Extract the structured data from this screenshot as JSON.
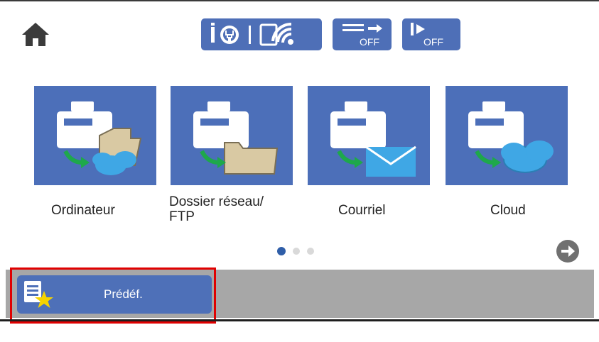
{
  "header": {
    "home_icon": "home-icon",
    "status_icons": [
      "wifi-direct-icon",
      "wifi-icon",
      "fax-forward-off-icon",
      "quiet-mode-off-icon"
    ],
    "off_label": "OFF"
  },
  "tiles": [
    {
      "label": "Ordinateur",
      "icon": "computer-scan-icon"
    },
    {
      "label": "Dossier réseau/\nFTP",
      "icon": "network-folder-scan-icon"
    },
    {
      "label": "Courriel",
      "icon": "email-scan-icon"
    },
    {
      "label": "Cloud",
      "icon": "cloud-scan-icon"
    }
  ],
  "pagination": {
    "pages": 3,
    "current": 1
  },
  "preset": {
    "label": "Prédéf.",
    "icon": "presets-icon"
  },
  "colors": {
    "tile_bg": "#4c6fb9",
    "button_bg": "#4e70b8",
    "bar_bg": "#a7a7a7",
    "highlight": "#e00000",
    "dot_active": "#2f5ea8",
    "dot_inactive": "#d9d9d9"
  }
}
